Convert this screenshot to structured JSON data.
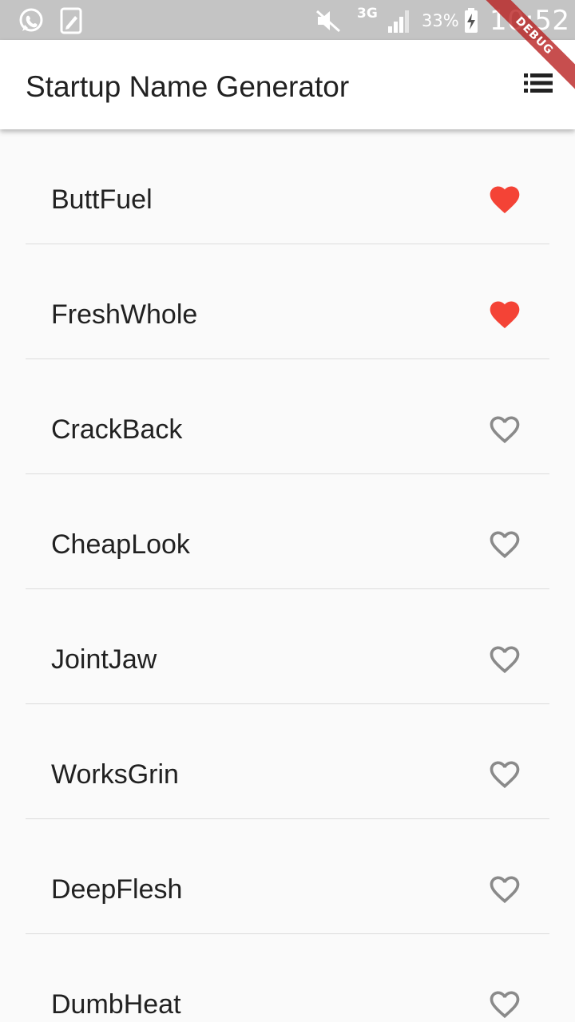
{
  "status_bar": {
    "network": "3G",
    "battery_percent": "33%",
    "clock": "10:52",
    "icons": [
      "whatsapp-icon",
      "notes-icon",
      "mute-icon",
      "signal-icon",
      "battery-charging-icon"
    ]
  },
  "debug_banner": {
    "label": "DEBUG"
  },
  "app_bar": {
    "title": "Startup Name Generator",
    "action_icon": "list-icon"
  },
  "colors": {
    "accent": "#f44336",
    "heart_outline": "#8a8a8a",
    "status_bar": "#c4c4c4",
    "app_bar": "#ffffff",
    "background": "#fafafa"
  },
  "items": [
    {
      "label": "ButtFuel",
      "saved": true
    },
    {
      "label": "FreshWhole",
      "saved": true
    },
    {
      "label": "CrackBack",
      "saved": false
    },
    {
      "label": "CheapLook",
      "saved": false
    },
    {
      "label": "JointJaw",
      "saved": false
    },
    {
      "label": "WorksGrin",
      "saved": false
    },
    {
      "label": "DeepFlesh",
      "saved": false
    },
    {
      "label": "DumbHeat",
      "saved": false
    }
  ]
}
